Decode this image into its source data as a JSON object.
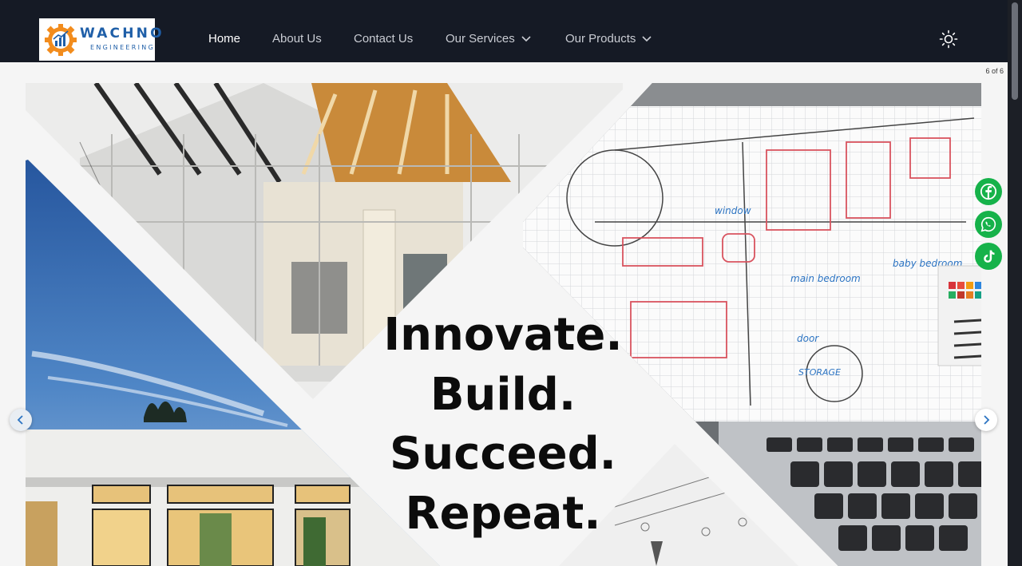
{
  "brand": {
    "name": "WACHNO",
    "tagline": "ENGINEERING"
  },
  "nav": {
    "items": [
      {
        "label": "Home",
        "active": true,
        "dropdown": false
      },
      {
        "label": "About Us",
        "active": false,
        "dropdown": false
      },
      {
        "label": "Contact Us",
        "active": false,
        "dropdown": false
      },
      {
        "label": "Our Services",
        "active": false,
        "dropdown": true
      },
      {
        "label": "Our Products",
        "active": false,
        "dropdown": true
      }
    ],
    "theme_toggle_icon": "sun-icon"
  },
  "carousel": {
    "counter": "6 of 6",
    "slogan_lines": [
      "Innovate.",
      "Build.",
      "Succeed.",
      "Repeat."
    ],
    "prev_icon": "chevron-left-icon",
    "next_icon": "chevron-right-icon",
    "sketch_labels": {
      "window": "window",
      "main_bedroom": "main bedroom",
      "baby_bedroom": "baby bedroom",
      "door": "door",
      "storage": "STORAGE"
    }
  },
  "social": [
    {
      "name": "facebook-icon"
    },
    {
      "name": "whatsapp-icon"
    },
    {
      "name": "tiktok-icon"
    }
  ],
  "colors": {
    "header_bg": "#151a25",
    "page_bg": "#f5f5f5",
    "social_green": "#16b24a",
    "brand_blue": "#1f5fa8",
    "brand_orange": "#f28c1d"
  }
}
